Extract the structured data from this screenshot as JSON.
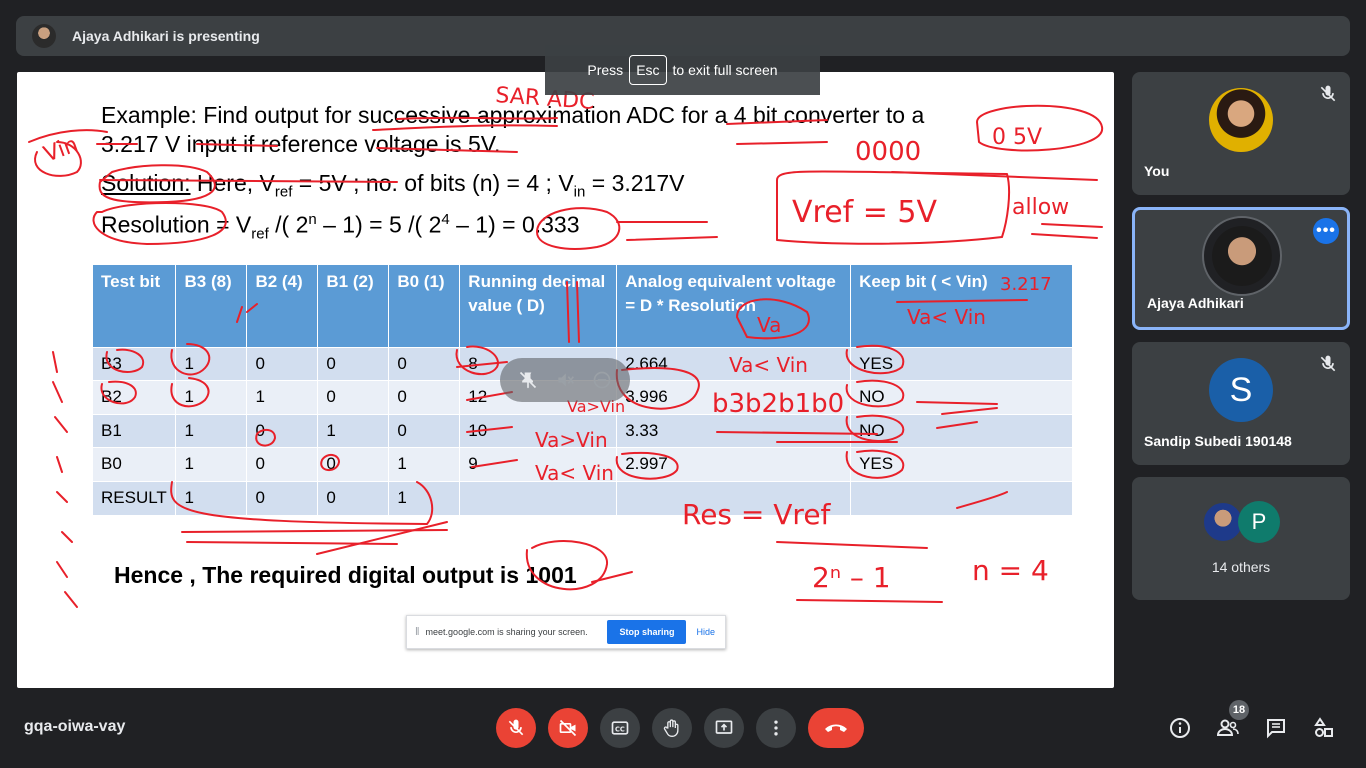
{
  "presenter": {
    "text": "Ajaya Adhikari is presenting"
  },
  "fullscreen_toast": {
    "press": "Press",
    "key": "Esc",
    "rest": "to exit full screen"
  },
  "slide": {
    "line1": "Example: Find output for successive approximation ADC for a 4 bit converter to a",
    "line2": "3.217 V input if reference voltage is 5V.",
    "solution_label": "Solution:",
    "solution_text": {
      "here": " Here, V",
      "ref_sub": "ref",
      "eq1": " = 5V ; no. of bits (n) = 4 ; V",
      "in_sub": "in",
      "eq2": " = 3.217V"
    },
    "resolution": {
      "a": "Resolution = V",
      "ref_sub": "ref",
      "b": " /( 2",
      "n_sup": "n",
      "c": " – 1) = 5 /( 2",
      "four_sup": "4",
      "d": " – 1) = 0.333"
    },
    "table": {
      "headers": [
        "Test bit",
        "B3 (8)",
        "B2 (4)",
        "B1 (2)",
        "B0 (1)",
        "Running decimal value ( D)",
        "Analog equivalent voltage = D * Resolution",
        "Keep bit ( < Vin)"
      ],
      "rows": [
        [
          "B3",
          "1",
          "0",
          "0",
          "0",
          "8",
          "2.664",
          "YES"
        ],
        [
          "B2",
          "1",
          "1",
          "0",
          "0",
          "12",
          "3.996",
          "NO"
        ],
        [
          "B1",
          "1",
          "0",
          "1",
          "0",
          "10",
          "3.33",
          "NO"
        ],
        [
          "B0",
          "1",
          "0",
          "0",
          "1",
          "9",
          "2.997",
          "YES"
        ],
        [
          "RESULT",
          "1",
          "0",
          "0",
          "1",
          "",
          "",
          ""
        ]
      ]
    },
    "conclusion": "Hence , The required digital output is 1001"
  },
  "annotations": {
    "sar_adc": "SAR ADC",
    "zeros": "0000",
    "zero_fivev": "0 5V",
    "vref5v": "Vref = 5V",
    "allow": "allow",
    "v_in": "Vin",
    "val_3217": "3.217",
    "va_lt_vin": "Va< Vin",
    "va_gt_vin": "Va>Vin",
    "b3b2b1b0": "b3b2b1b0",
    "res_eq": "Res = Vref",
    "two_n_minus_1": "2ⁿ – 1",
    "n_eq_4": "n = 4",
    "va": "Va"
  },
  "share_notice": {
    "message": "meet.google.com is sharing your screen.",
    "stop": "Stop sharing",
    "hide": "Hide"
  },
  "participants": [
    {
      "name": "You",
      "muted": true
    },
    {
      "name": "Ajaya Adhikari",
      "muted": false
    },
    {
      "name": "Sandip Subedi 190148",
      "initial": "S",
      "muted": true
    },
    {
      "name": "14 others",
      "extra_initial": "P"
    }
  ],
  "meeting_code": "gqa-oiwa-vay",
  "people_count": "18",
  "colors": {
    "accent": "#1a73e8",
    "danger": "#ea4335",
    "tile": "#3c4043",
    "bg": "#202124",
    "table_header": "#5b9bd5",
    "ink": "#e8202a"
  }
}
